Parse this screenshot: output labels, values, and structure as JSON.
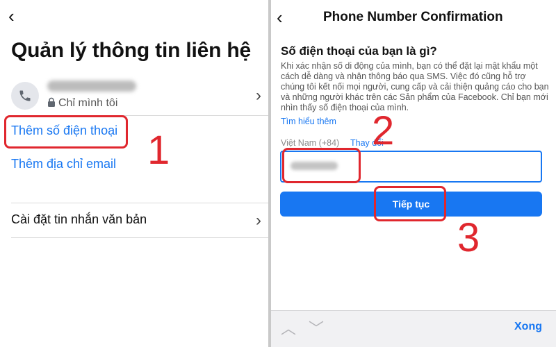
{
  "left_screen": {
    "back_glyph": "‹",
    "title": "Quản lý thông tin liên hệ",
    "phone": {
      "privacy_label": "Chỉ mình tôi",
      "icon": "phone-icon"
    },
    "add_phone_label": "Thêm số điện thoại",
    "add_email_label": "Thêm địa chỉ email",
    "sms_settings_label": "Cài đặt tin nhắn văn bản"
  },
  "right_screen": {
    "back_glyph": "‹",
    "header_title": "Phone Number Confirmation",
    "section_title": "Số điện thoại của bạn là gì?",
    "description": "Khi xác nhận số di động của mình, bạn có thể đặt lại mật khẩu một cách dễ dàng và nhận thông báo qua SMS. Việc đó cũng hỗ trợ chúng tôi kết nối mọi người, cung cấp và cải thiện quảng cáo cho bạn và những người khác trên các Sản phẩm của Facebook. Chỉ bạn mới nhìn thấy số điện thoại của mình.",
    "learn_more_label": "Tìm hiểu thêm",
    "country_label": "Việt Nam (+84)",
    "change_label": "Thay đổi",
    "continue_label": "Tiếp tục",
    "keyboard_done_label": "Xong"
  },
  "annotations": {
    "step1": "1",
    "step2": "2",
    "step3": "3",
    "highlight_color": "#e0272e"
  },
  "colors": {
    "accent": "#1877f2",
    "divider": "#c9c9c9"
  }
}
